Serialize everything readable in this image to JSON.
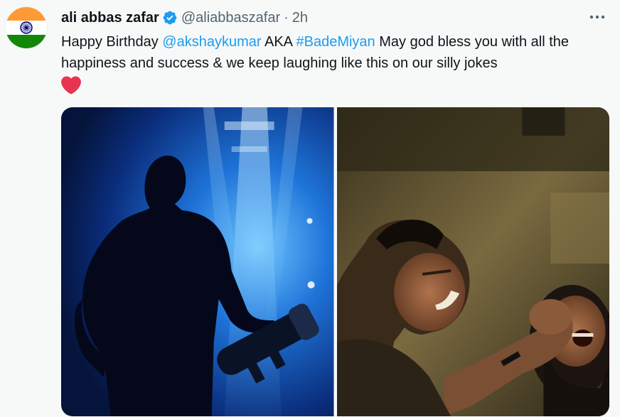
{
  "tweet": {
    "author_name": "ali abbas zafar",
    "handle": "@aliabbaszafar",
    "separator": "·",
    "timestamp": "2h",
    "more_icon": "more-horizontal-icon",
    "verified_icon": "verified-badge-icon",
    "text": {
      "part1": "Happy Birthday ",
      "mention": "@akshaykumar",
      "part2": " AKA ",
      "hashtag": "#BadeMiyan",
      "part3": " May god bless you with all the happiness and success & we keep laughing like this on our silly jokes"
    },
    "emoji_icon": "red-heart-icon",
    "colors": {
      "link": "#1d9bf0",
      "verified": "#1d9bf0",
      "secondary_text": "#536471",
      "background": "#f7f9f9",
      "heart": "#e8344e"
    }
  },
  "media": {
    "count": 2,
    "photo_1": "stage-silhouette-photo",
    "photo_2": "laughing-men-photo"
  }
}
